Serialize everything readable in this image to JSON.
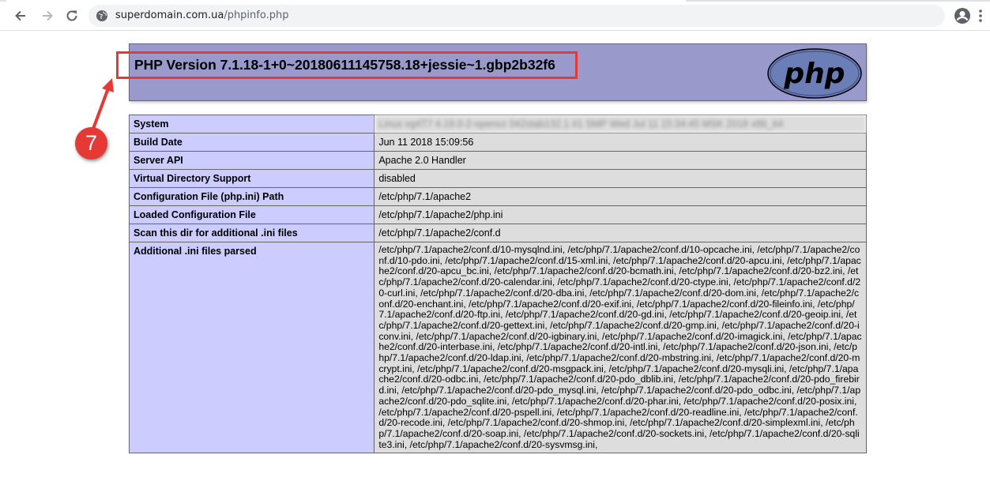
{
  "browser": {
    "url_host": "superdomain.com.ua",
    "url_path": "/phpinfo.php"
  },
  "php": {
    "version_title": "PHP Version 7.1.18-1+0~20180611145758.18+jessie~1.gbp2b32f6",
    "logo_text": "php"
  },
  "table": {
    "rows": [
      {
        "key": "System",
        "value": "Linux vg4T7 4.19.0-2-openvz 042stab132.1 #1 SMP Wed Jul 11 15:34:45 MSK 2018 x86_64"
      },
      {
        "key": "Build Date",
        "value": "Jun 11 2018 15:09:56"
      },
      {
        "key": "Server API",
        "value": "Apache 2.0 Handler"
      },
      {
        "key": "Virtual Directory Support",
        "value": "disabled"
      },
      {
        "key": "Configuration File (php.ini) Path",
        "value": "/etc/php/7.1/apache2"
      },
      {
        "key": "Loaded Configuration File",
        "value": "/etc/php/7.1/apache2/php.ini"
      },
      {
        "key": "Scan this dir for additional .ini files",
        "value": "/etc/php/7.1/apache2/conf.d"
      },
      {
        "key": "Additional .ini files parsed",
        "value": "/etc/php/7.1/apache2/conf.d/10-mysqlnd.ini, /etc/php/7.1/apache2/conf.d/10-opcache.ini, /etc/php/7.1/apache2/conf.d/10-pdo.ini, /etc/php/7.1/apache2/conf.d/15-xml.ini, /etc/php/7.1/apache2/conf.d/20-apcu.ini, /etc/php/7.1/apache2/conf.d/20-apcu_bc.ini, /etc/php/7.1/apache2/conf.d/20-bcmath.ini, /etc/php/7.1/apache2/conf.d/20-bz2.ini, /etc/php/7.1/apache2/conf.d/20-calendar.ini, /etc/php/7.1/apache2/conf.d/20-ctype.ini, /etc/php/7.1/apache2/conf.d/20-curl.ini, /etc/php/7.1/apache2/conf.d/20-dba.ini, /etc/php/7.1/apache2/conf.d/20-dom.ini, /etc/php/7.1/apache2/conf.d/20-enchant.ini, /etc/php/7.1/apache2/conf.d/20-exif.ini, /etc/php/7.1/apache2/conf.d/20-fileinfo.ini, /etc/php/7.1/apache2/conf.d/20-ftp.ini, /etc/php/7.1/apache2/conf.d/20-gd.ini, /etc/php/7.1/apache2/conf.d/20-geoip.ini, /etc/php/7.1/apache2/conf.d/20-gettext.ini, /etc/php/7.1/apache2/conf.d/20-gmp.ini, /etc/php/7.1/apache2/conf.d/20-iconv.ini, /etc/php/7.1/apache2/conf.d/20-igbinary.ini, /etc/php/7.1/apache2/conf.d/20-imagick.ini, /etc/php/7.1/apache2/conf.d/20-interbase.ini, /etc/php/7.1/apache2/conf.d/20-intl.ini, /etc/php/7.1/apache2/conf.d/20-json.ini, /etc/php/7.1/apache2/conf.d/20-ldap.ini, /etc/php/7.1/apache2/conf.d/20-mbstring.ini, /etc/php/7.1/apache2/conf.d/20-mcrypt.ini, /etc/php/7.1/apache2/conf.d/20-msgpack.ini, /etc/php/7.1/apache2/conf.d/20-mysqli.ini, /etc/php/7.1/apache2/conf.d/20-odbc.ini, /etc/php/7.1/apache2/conf.d/20-pdo_dblib.ini, /etc/php/7.1/apache2/conf.d/20-pdo_firebird.ini, /etc/php/7.1/apache2/conf.d/20-pdo_mysql.ini, /etc/php/7.1/apache2/conf.d/20-pdo_odbc.ini, /etc/php/7.1/apache2/conf.d/20-pdo_sqlite.ini, /etc/php/7.1/apache2/conf.d/20-phar.ini, /etc/php/7.1/apache2/conf.d/20-posix.ini, /etc/php/7.1/apache2/conf.d/20-pspell.ini, /etc/php/7.1/apache2/conf.d/20-readline.ini, /etc/php/7.1/apache2/conf.d/20-recode.ini, /etc/php/7.1/apache2/conf.d/20-shmop.ini, /etc/php/7.1/apache2/conf.d/20-simplexml.ini, /etc/php/7.1/apache2/conf.d/20-soap.ini, /etc/php/7.1/apache2/conf.d/20-sockets.ini, /etc/php/7.1/apache2/conf.d/20-sqlite3.ini, /etc/php/7.1/apache2/conf.d/20-sysvmsg.ini,"
      }
    ]
  },
  "annotation": {
    "step_number": "7",
    "color": "#e53935"
  }
}
